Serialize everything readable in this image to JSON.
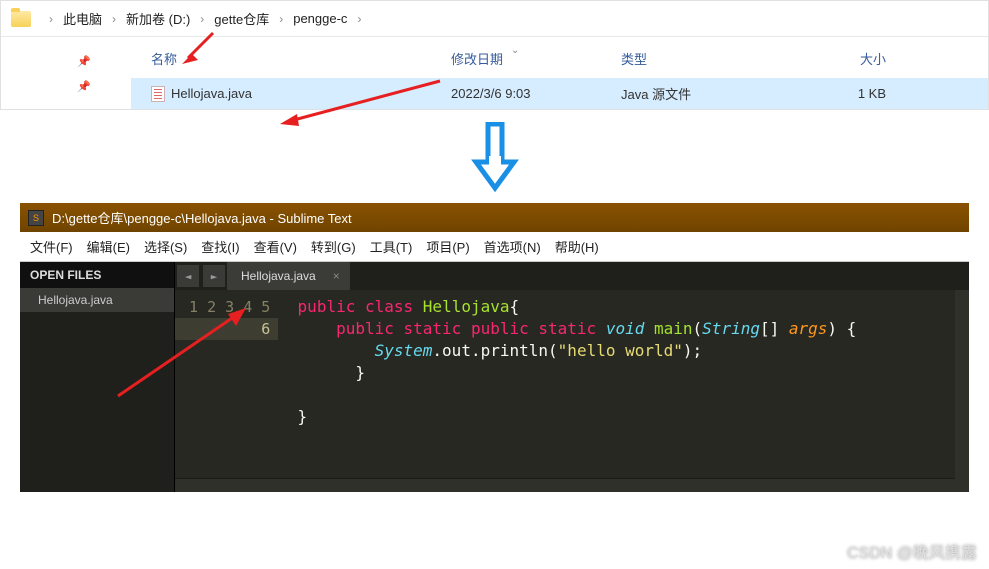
{
  "explorer": {
    "breadcrumb": [
      "此电脑",
      "新加卷 (D:)",
      "gette仓库",
      "pengge-c"
    ],
    "columns": {
      "name": "名称",
      "date": "修改日期",
      "type": "类型",
      "size": "大小"
    },
    "file": {
      "name": "Hellojava.java",
      "date": "2022/3/6 9:03",
      "type": "Java 源文件",
      "size": "1 KB"
    }
  },
  "sublime": {
    "title": "D:\\gette仓库\\pengge-c\\Hellojava.java - Sublime Text",
    "menu": [
      "文件(F)",
      "编辑(E)",
      "选择(S)",
      "查找(I)",
      "查看(V)",
      "转到(G)",
      "工具(T)",
      "项目(P)",
      "首选项(N)",
      "帮助(H)"
    ],
    "open_files_label": "OPEN FILES",
    "open_file": "Hellojava.java",
    "tab": "Hellojava.java",
    "tab_nav": {
      "prev": "◄",
      "next": "►"
    },
    "tab_close": "×",
    "line_numbers": [
      "1",
      "2",
      "3",
      "4",
      "5",
      "6"
    ],
    "code": {
      "l1": {
        "kw1": "public",
        "kw2": "class",
        "cls": "Hellojava",
        "tail": "{"
      },
      "l2": {
        "kw1": "public",
        "kw2": "static",
        "kw3": "public",
        "kw4": "static",
        "type": "void",
        "fn": "main",
        "p1": "(",
        "ptype": "String",
        "parr": "[]",
        "pvar": "args",
        "p2": ") {"
      },
      "l3": {
        "cls": "System",
        "dot1": ".",
        "m1": "out",
        "dot2": ".",
        "m2": "println",
        "p1": "(",
        "str": "\"hello world\"",
        "p2": ");"
      },
      "l4": "        }",
      "l5": "",
      "l6": "}"
    }
  },
  "watermark": "CSDN @晚风携露"
}
